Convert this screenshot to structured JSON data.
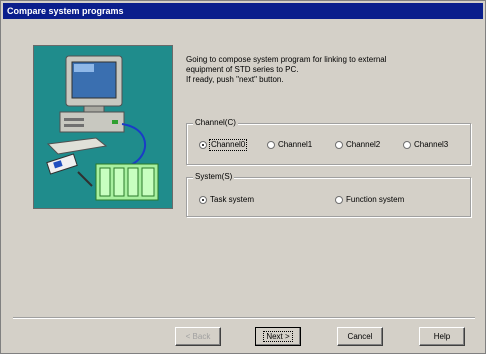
{
  "window": {
    "title": "Compare system programs"
  },
  "description": {
    "line1": "Going to compose system program for linking to external",
    "line2": "equipment of STD series to PC.",
    "line3": "If ready, push \"next\" button."
  },
  "channel_group": {
    "legend": "Channel(C)",
    "options": [
      {
        "label": "Channel0",
        "checked": true
      },
      {
        "label": "Channel1",
        "checked": false
      },
      {
        "label": "Channel2",
        "checked": false
      },
      {
        "label": "Channel3",
        "checked": false
      }
    ]
  },
  "system_group": {
    "legend": "System(S)",
    "options": [
      {
        "label": "Task system",
        "checked": true
      },
      {
        "label": "Function system",
        "checked": false
      }
    ]
  },
  "buttons": {
    "back": "< Back",
    "next": "Next >",
    "cancel": "Cancel",
    "help": "Help"
  },
  "colors": {
    "titlebar": "#0a1e8c",
    "illustration_bg": "#1f8c8c",
    "face": "#d4d0c8"
  },
  "icons": {
    "illustration": "computer-linked-to-external-equipment-icon"
  }
}
